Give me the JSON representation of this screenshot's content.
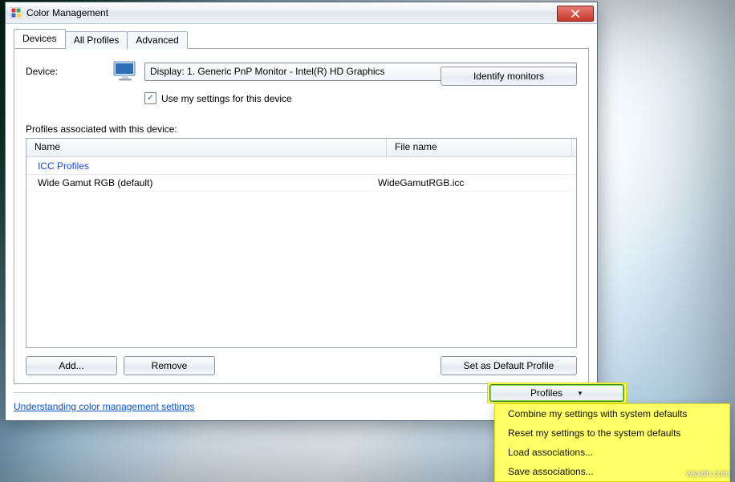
{
  "window": {
    "title": "Color Management"
  },
  "tabs": {
    "devices": "Devices",
    "all_profiles": "All Profiles",
    "advanced": "Advanced"
  },
  "device": {
    "label": "Device:",
    "selected": "Display: 1. Generic PnP Monitor - Intel(R) HD Graphics",
    "use_my_settings": "Use my settings for this device",
    "identify_monitors": "Identify monitors"
  },
  "profiles_section": {
    "heading": "Profiles associated with this device:",
    "columns": {
      "name": "Name",
      "file": "File name"
    },
    "group": "ICC Profiles",
    "rows": [
      {
        "name": "Wide Gamut RGB (default)",
        "file": "WideGamutRGB.icc"
      }
    ]
  },
  "buttons": {
    "add": "Add...",
    "remove": "Remove",
    "set_default": "Set as Default Profile",
    "profiles": "Profiles"
  },
  "footer": {
    "help_link": "Understanding color management settings"
  },
  "profiles_menu": {
    "combine": "Combine my settings with system defaults",
    "reset": "Reset my settings to the system defaults",
    "load": "Load associations...",
    "save": "Save associations..."
  },
  "watermark": "wsxdn.com"
}
